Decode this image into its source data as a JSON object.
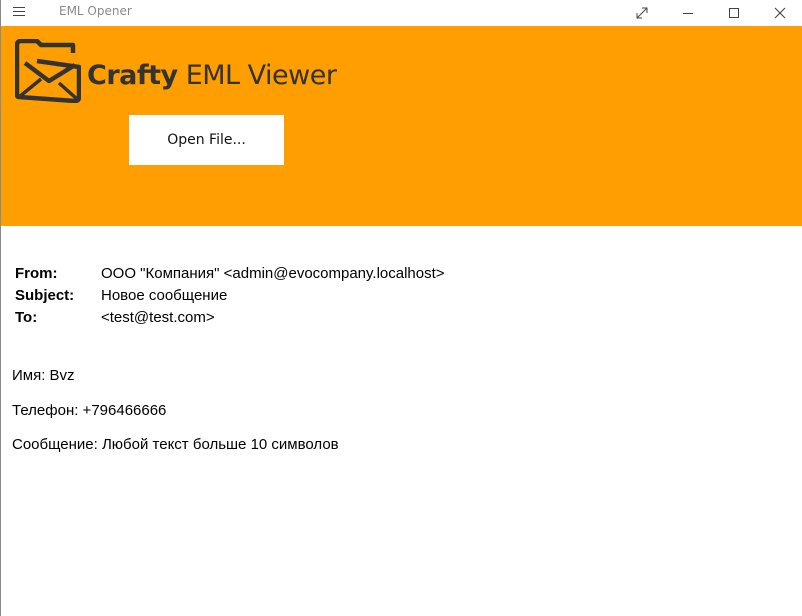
{
  "window": {
    "title": "EML Opener"
  },
  "header": {
    "brand_bold": "Crafty",
    "brand_rest": " EML Viewer",
    "background_color": "#ff9e00",
    "open_button_label": "Open File..."
  },
  "email": {
    "from_label": "From:",
    "from_value": "ООО \"Компания\" <admin@evocompany.localhost>",
    "subject_label": "Subject:",
    "subject_value": "Новое сообщение",
    "to_label": "To:",
    "to_value": "<test@test.com>",
    "body_lines": [
      "Имя: Bvz",
      "Телефон: +796466666",
      "Сообщение: Любой текст больше 10 символов"
    ]
  }
}
